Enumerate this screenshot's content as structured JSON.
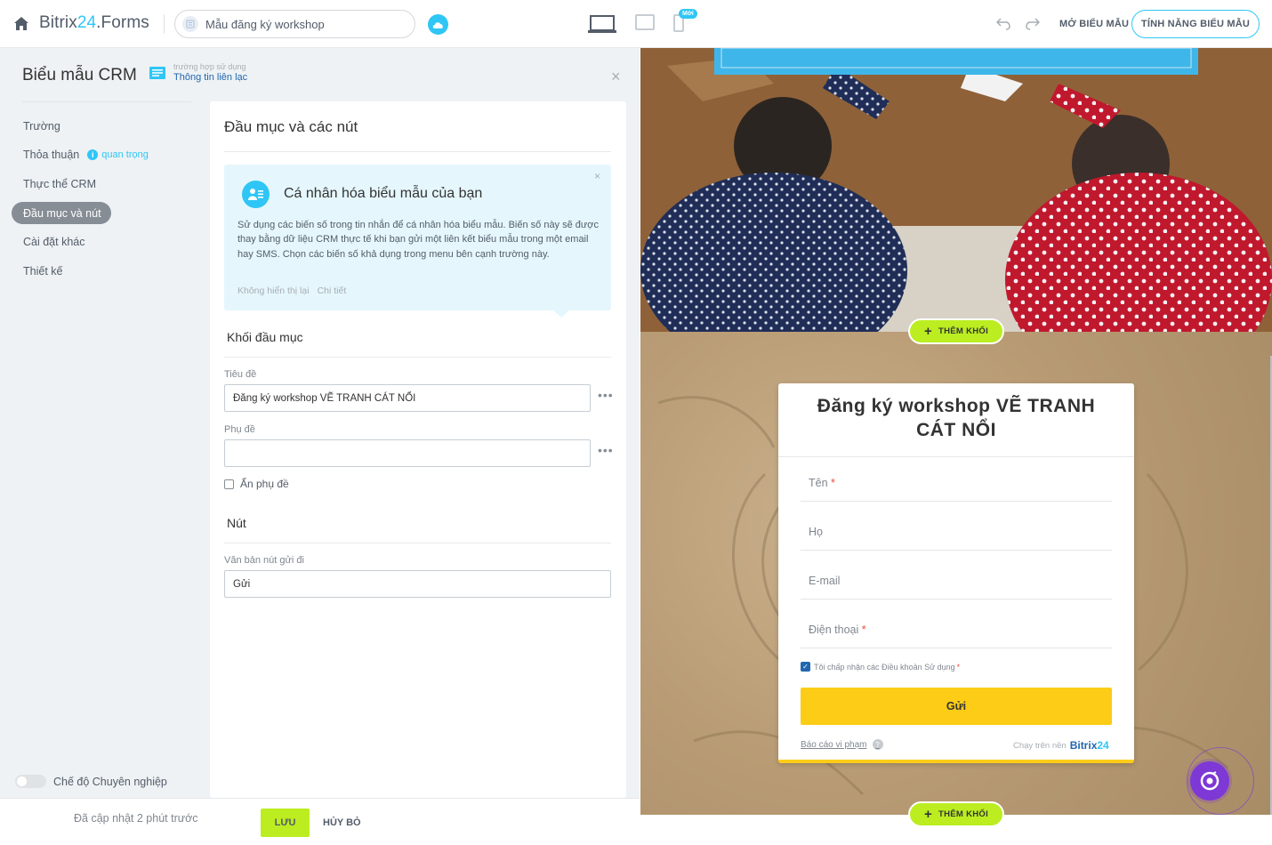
{
  "header": {
    "logo_main": "Bitrix",
    "logo_num": "24",
    "logo_suffix": ".Forms",
    "form_name": "Mẫu đăng ký workshop",
    "new_badge": "Mới",
    "open_form_label": "MỞ BIỂU MẪU",
    "form_features_label": "TÍNH NĂNG BIỂU MẪU"
  },
  "panel": {
    "title": "Biểu mẫu CRM",
    "usecase_small": "trường hợp sử dụng",
    "usecase_link": "Thông tin liên lạc",
    "nav": [
      {
        "label": "Trường"
      },
      {
        "label": "Thỏa thuận",
        "note": "quan trọng"
      },
      {
        "label": "Thực thể CRM"
      },
      {
        "label": "Đầu mục và nút",
        "active": true
      },
      {
        "label": "Cài đặt khác"
      },
      {
        "label": "Thiết kế"
      }
    ],
    "pro_mode_label": "Chế độ Chuyên nghiệp"
  },
  "card": {
    "title": "Đầu mục và các nút",
    "hint": {
      "title": "Cá nhân hóa biểu mẫu của bạn",
      "text": "Sử dụng các biến số trong tin nhắn để cá nhân hóa biểu mẫu. Biến số này sẽ được thay bằng dữ liệu CRM thực tế khi bạn gửi một liên kết biểu mẫu trong một email hay SMS. Chọn các biến số khả dụng trong menu bên cạnh trường này.",
      "dont_show": "Không hiển thị lại",
      "details": "Chi tiết"
    },
    "header_block_title": "Khối đầu mục",
    "title_label": "Tiêu đề",
    "title_value": "Đăng ký workshop VẼ TRANH CÁT NỔI",
    "subtitle_label": "Phụ đề",
    "subtitle_value": "",
    "hide_subtitle_label": "Ẩn phụ đề",
    "button_section_title": "Nút",
    "submit_text_label": "Văn bản nút gửi đi",
    "submit_text_value": "Gửi"
  },
  "footer": {
    "updated": "Đã cập nhật 2 phút trước",
    "save": "LƯU",
    "cancel": "HỦY BỎ"
  },
  "preview": {
    "add_block_label": "THÊM KHỐI",
    "form_title": "Đăng ký workshop VẼ TRANH CÁT NỔI",
    "fields": [
      {
        "label": "Tên",
        "required": true
      },
      {
        "label": "Họ",
        "required": false
      },
      {
        "label": "E-mail",
        "required": false
      },
      {
        "label": "Điện thoại",
        "required": true
      }
    ],
    "agree_text": "Tôi chấp nhận các Điều khoản Sử dụng",
    "submit": "Gửi",
    "report": "Báo cáo vi phạm",
    "powered_by": "Chạy trên nền",
    "brand_a": "Bitrix",
    "brand_b": "24"
  },
  "colors": {
    "accent": "#2fc6f6",
    "save_green": "#bbed21",
    "submit_yellow": "#fccc17",
    "chat_purple": "#7d38d6"
  }
}
